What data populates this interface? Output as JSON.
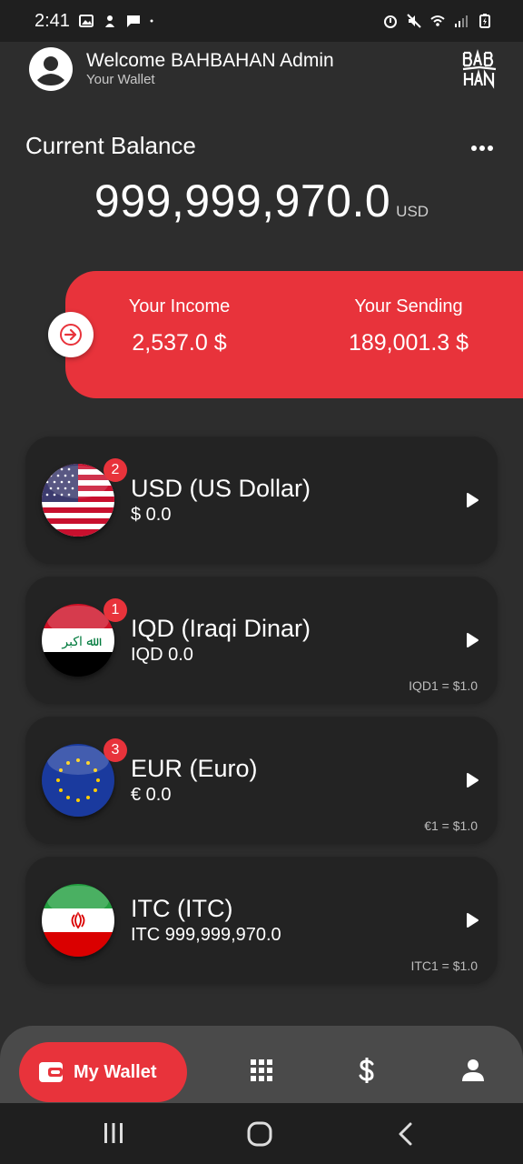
{
  "status_bar": {
    "time": "2:41"
  },
  "header": {
    "welcome": "Welcome BAHBAHAN Admin",
    "subtitle": "Your Wallet"
  },
  "balance": {
    "label": "Current Balance",
    "value": "999,999,970.0",
    "unit": "USD"
  },
  "summary": {
    "income_label": "Your Income",
    "income_value": "2,537.0 $",
    "sending_label": "Your Sending",
    "sending_value": "189,001.3 $"
  },
  "currencies": [
    {
      "name": "USD (US Dollar)",
      "amount": "$ 0.0",
      "badge": "2",
      "rate": "",
      "flag": "us-flag"
    },
    {
      "name": "IQD (Iraqi Dinar)",
      "amount": "IQD 0.0",
      "badge": "1",
      "rate": "IQD1 = $1.0",
      "flag": "iraq-flag"
    },
    {
      "name": "EUR (Euro)",
      "amount": "€ 0.0",
      "badge": "3",
      "rate": "€1 = $1.0",
      "flag": "eu-flag"
    },
    {
      "name": "ITC (ITC)",
      "amount": "ITC 999,999,970.0",
      "badge": "",
      "rate": "ITC1 = $1.0",
      "flag": "iran-flag"
    }
  ],
  "bottom_nav": {
    "wallet_label": "My Wallet",
    "items": [
      "wallet-icon",
      "grid-icon",
      "dollar-icon",
      "person-icon"
    ]
  },
  "colors": {
    "background": "#2d2d2d",
    "card": "#232323",
    "accent": "#e8333b",
    "nav": "#4a4a4a"
  }
}
